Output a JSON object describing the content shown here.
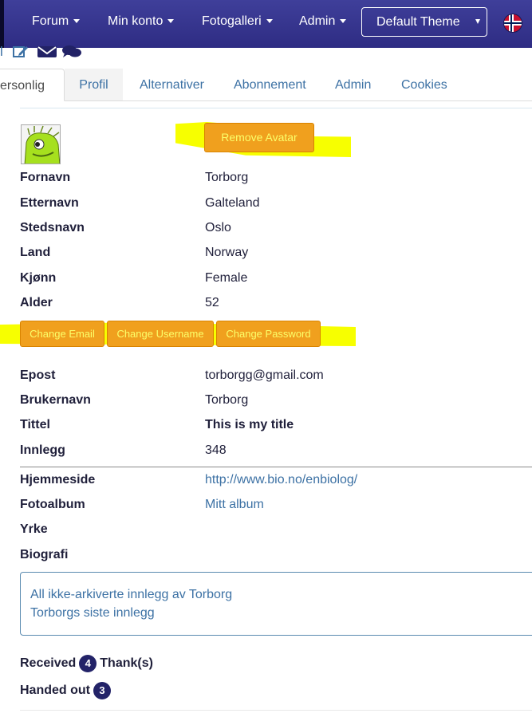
{
  "navbar": {
    "items": [
      {
        "label": "Forum"
      },
      {
        "label": "Min konto"
      },
      {
        "label": "Fotogalleri"
      },
      {
        "label": "Admin"
      }
    ],
    "theme_select": {
      "value": "Default Theme"
    },
    "language_flag": "norway-flag-icon"
  },
  "icons": {
    "left_partial": "l",
    "edit": "edit-icon",
    "mail": "envelope-icon",
    "chat": "chat-icon"
  },
  "tabs": [
    {
      "label": "ersonlig",
      "active": true
    },
    {
      "label": "Profil"
    },
    {
      "label": "Alternativer"
    },
    {
      "label": "Abonnement"
    },
    {
      "label": "Admin"
    },
    {
      "label": "Cookies"
    }
  ],
  "avatar": {
    "remove_label": "Remove Avatar"
  },
  "personal": [
    {
      "label": "Fornavn",
      "value": "Torborg"
    },
    {
      "label": "Etternavn",
      "value": "Galteland"
    },
    {
      "label": "Stedsnavn",
      "value": "Oslo"
    },
    {
      "label": "Land",
      "value": "Norway"
    },
    {
      "label": "Kjønn",
      "value": "Female"
    },
    {
      "label": "Alder",
      "value": "52"
    }
  ],
  "change_buttons": {
    "email": "Change Email",
    "username": "Change Username",
    "password": "Change Password"
  },
  "account": [
    {
      "label": "Epost",
      "value": "torborgg@gmail.com"
    },
    {
      "label": "Brukernavn",
      "value": "Torborg"
    },
    {
      "label": "Tittel",
      "value": "This is my title"
    },
    {
      "label": "Innlegg",
      "value": "348"
    }
  ],
  "extra": [
    {
      "label": "Hjemmeside",
      "value": "http://www.bio.no/enbiolog/"
    },
    {
      "label": "Fotoalbum",
      "value": "Mitt album"
    },
    {
      "label": "Yrke",
      "value": ""
    },
    {
      "label": "Biografi",
      "value": ""
    }
  ],
  "posts": {
    "all_posts": "All ikke-arkiverte innlegg av Torborg",
    "latest_posts": "Torborgs siste innlegg"
  },
  "thanks": {
    "received_label": "Received",
    "received_count": "4",
    "received_suffix": "Thank(s)",
    "handed_label": "Handed out",
    "handed_count": "3"
  },
  "colors": {
    "navbar": "#3a3890",
    "accent_link": "#3c71a4",
    "button_orange": "#f0a01e",
    "highlight": "#f7ff00",
    "badge": "#232368"
  }
}
